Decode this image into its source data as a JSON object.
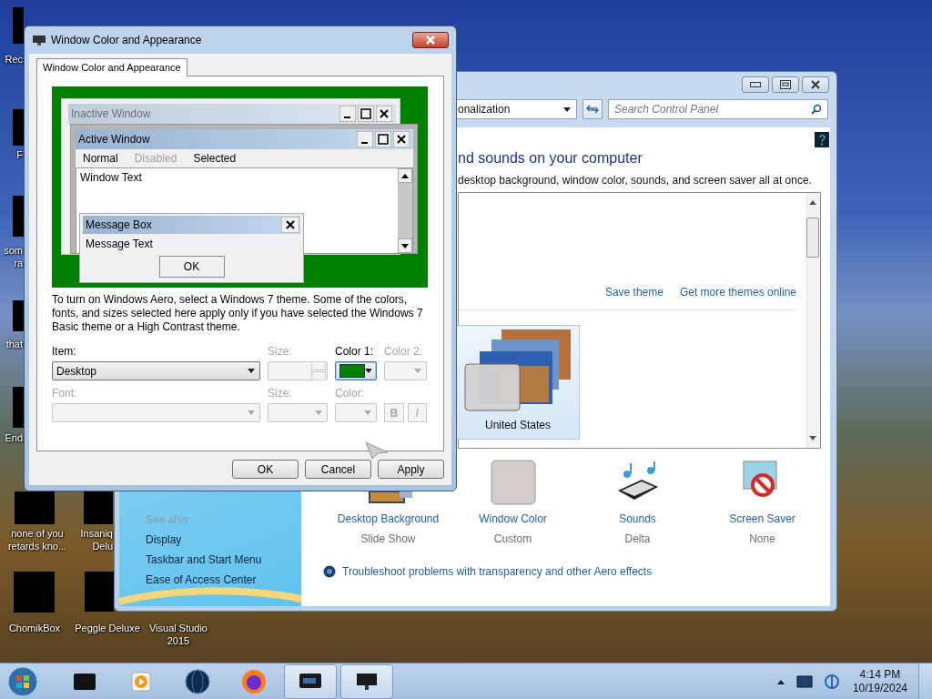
{
  "desktop_icons": [
    {
      "lines": [
        "Rec"
      ]
    },
    {
      "lines": [
        "F"
      ]
    },
    {
      "lines": [
        "som",
        "ra"
      ]
    },
    {
      "lines": [
        "that"
      ]
    },
    {
      "lines": [
        "End"
      ]
    },
    {
      "lines": [
        "none of you",
        "retards kno..."
      ]
    },
    {
      "lines": [
        "Insaniq",
        "Delu"
      ]
    },
    {
      "lines": [
        "ChomikBox"
      ]
    },
    {
      "lines": [
        "Peggle Deluxe"
      ]
    },
    {
      "lines": [
        "Visual Studio",
        "2015"
      ]
    }
  ],
  "control_panel": {
    "address": "onalization",
    "search": {
      "placeholder": "Search Control Panel"
    },
    "heading": "nd sounds on your computer",
    "subtitle": "desktop background, window color, sounds, and screen saver all at once.",
    "links": [
      "Save theme",
      "Get more themes online"
    ],
    "themes": [
      {
        "name": "United States",
        "selected": true
      }
    ],
    "settings": [
      {
        "kind": "background",
        "label": "Desktop Background",
        "value": "Slide Show"
      },
      {
        "kind": "color",
        "label": "Window Color",
        "value": "Custom"
      },
      {
        "kind": "sounds",
        "label": "Sounds",
        "value": "Delta"
      },
      {
        "kind": "saver",
        "label": "Screen Saver",
        "value": "None"
      }
    ],
    "troubleshoot": "Troubleshoot problems with transparency and other Aero effects",
    "see_also": {
      "title": "See also",
      "links": [
        "Display",
        "Taskbar and Start Menu",
        "Ease of Access Center"
      ]
    }
  },
  "dialog": {
    "title": "Window Color and Appearance",
    "tabs": [
      {
        "label": "Window Color and Appearance",
        "selected": true
      }
    ],
    "preview": {
      "inactive_title": "Inactive Window",
      "active_title": "Active Window",
      "menu": [
        {
          "label": "Normal",
          "disabled": false
        },
        {
          "label": "Disabled",
          "disabled": true
        },
        {
          "label": "Selected",
          "disabled": false
        }
      ],
      "window_text": "Window Text",
      "message_title": "Message Box",
      "message_text": "Message Text",
      "ok": "OK"
    },
    "description": "To turn on Windows Aero, select a Windows 7 theme.  Some of the colors, fonts, and sizes selected here apply only if you have selected the Windows 7 Basic theme or a High Contrast theme.",
    "fields": [
      {
        "kind": "dropdown",
        "label": "Item:",
        "value": "Desktop",
        "disabled": false
      },
      {
        "kind": "spinner",
        "label": "Size:",
        "disabled": true
      },
      {
        "kind": "color",
        "label": "Color 1:",
        "color": "#008000",
        "disabled": false
      },
      {
        "kind": "color",
        "label": "Color 2:",
        "disabled": true
      },
      {
        "kind": "dropdown",
        "label": "Font:",
        "disabled": true
      },
      {
        "kind": "dropdown",
        "label": "Size:",
        "disabled": true
      },
      {
        "kind": "color",
        "label": "Color:",
        "disabled": true
      },
      {
        "kind": "styles",
        "buttons": [
          "B",
          "I"
        ],
        "disabled": true
      }
    ],
    "buttons": [
      "OK",
      "Cancel",
      "Apply"
    ]
  },
  "taskbar": {
    "items": [
      {
        "kind": "box",
        "active": false
      },
      {
        "kind": "media",
        "active": false
      },
      {
        "kind": "globe",
        "active": false
      },
      {
        "kind": "firefox",
        "active": false
      },
      {
        "kind": "dialog",
        "active": true
      },
      {
        "kind": "monitor",
        "active": true
      }
    ],
    "time": "4:14 PM",
    "date": "10/19/2024"
  }
}
